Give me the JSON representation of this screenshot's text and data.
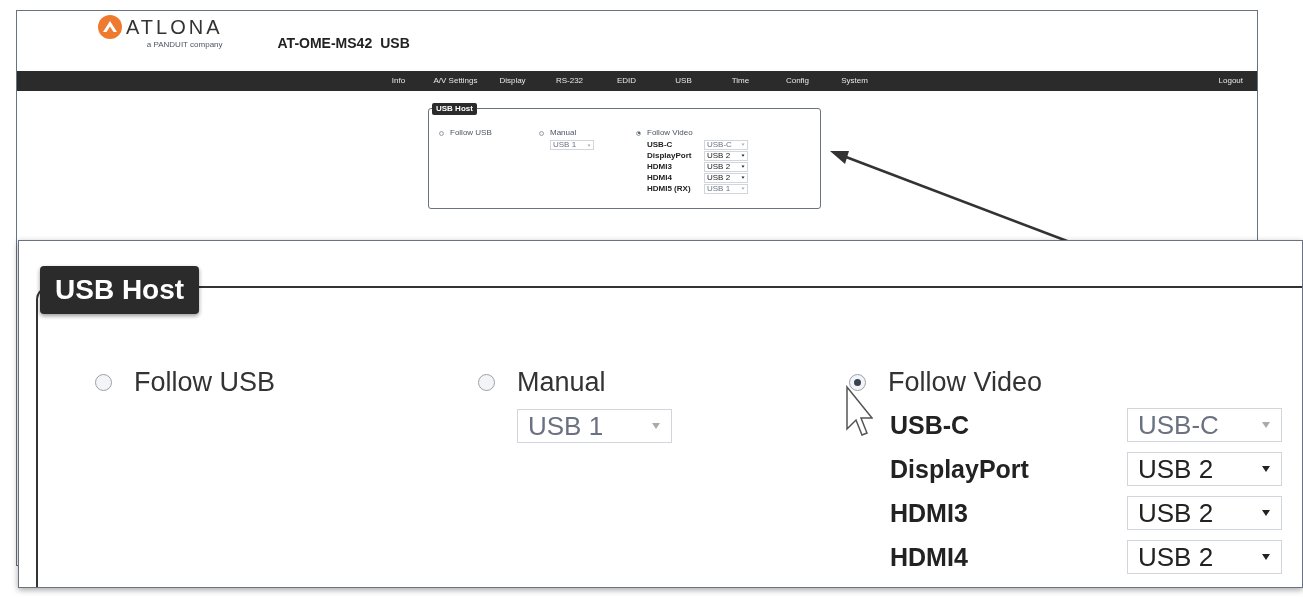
{
  "logo": {
    "name": "ATLONA",
    "tagline": "a PANDUIT company"
  },
  "page_title": {
    "model": "AT-OME-MS42",
    "section": "USB"
  },
  "nav": {
    "items": [
      "Info",
      "A/V Settings",
      "Display",
      "RS-232",
      "EDID",
      "USB",
      "Time",
      "Config",
      "System"
    ],
    "logout": "Logout"
  },
  "usb_host": {
    "title": "USB Host",
    "options": [
      {
        "label": "Follow USB",
        "selected": false
      },
      {
        "label": "Manual",
        "selected": false,
        "select": {
          "value": "USB 1",
          "disabled": true
        }
      },
      {
        "label": "Follow Video",
        "selected": true,
        "rows": [
          {
            "label": "USB-C",
            "value": "USB-C",
            "disabled": true
          },
          {
            "label": "DisplayPort",
            "value": "USB 2",
            "disabled": false
          },
          {
            "label": "HDMI3",
            "value": "USB 2",
            "disabled": false
          },
          {
            "label": "HDMI4",
            "value": "USB 2",
            "disabled": false
          },
          {
            "label": "HDMI5 (RX)",
            "value": "USB 1",
            "disabled": true
          }
        ]
      }
    ]
  },
  "zoom_inset": {
    "usb_host": {
      "title": "USB Host",
      "options": [
        {
          "label": "Follow USB",
          "selected": false
        },
        {
          "label": "Manual",
          "selected": false,
          "select": {
            "value": "USB 1",
            "disabled": true
          }
        },
        {
          "label": "Follow Video",
          "selected": true,
          "rows": [
            {
              "label": "USB-C",
              "value": "USB-C",
              "disabled": true
            },
            {
              "label": "DisplayPort",
              "value": "USB 2",
              "disabled": false
            },
            {
              "label": "HDMI3",
              "value": "USB 2",
              "disabled": false
            },
            {
              "label": "HDMI4",
              "value": "USB 2",
              "disabled": false
            }
          ]
        }
      ]
    }
  }
}
